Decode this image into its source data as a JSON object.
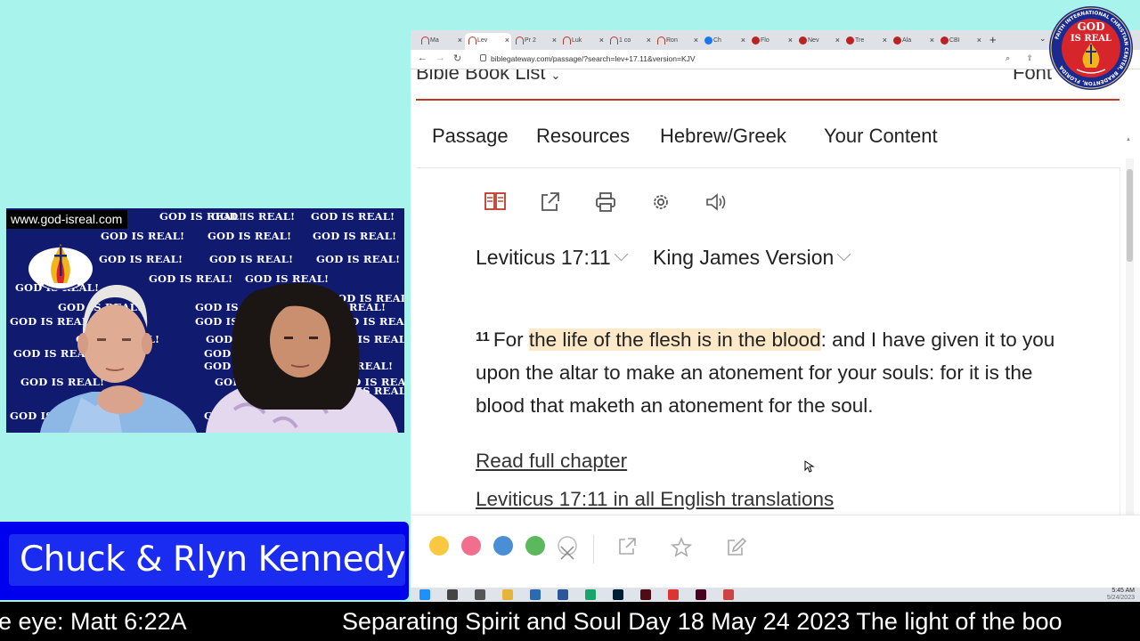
{
  "webcam": {
    "url_tag": "www.god-isreal.com",
    "backdrop_text": "GOD IS REAL!",
    "emblem_text": "GOD IS REAL"
  },
  "presenters": {
    "name": "Chuck & Rlyn Kennedy"
  },
  "ticker": {
    "left_fragment": "e eye: Matt 6:22A",
    "right_fragment": "Separating Spirit and Soul Day 18 May 24 2023 The light of the boo"
  },
  "corner_logo": {
    "line1": "GOD",
    "line2": "IS REAL",
    "ring_text": "FAITH INTERNATIONAL CHRISTIAN CENTER, BRADENTON, FLORIDA"
  },
  "browser": {
    "tabs": [
      {
        "label": "Ma",
        "icon": "bible-gateway-icon",
        "active": false
      },
      {
        "label": "Lev",
        "icon": "bible-gateway-icon",
        "active": true
      },
      {
        "label": "Pr 2",
        "icon": "bible-gateway-icon",
        "active": false
      },
      {
        "label": "Luk",
        "icon": "bible-gateway-icon",
        "active": false
      },
      {
        "label": "1 co",
        "icon": "bible-gateway-icon",
        "active": false
      },
      {
        "label": "Ron",
        "icon": "bible-gateway-icon",
        "active": false
      },
      {
        "label": "Ch",
        "icon": "facebook-icon",
        "active": false
      },
      {
        "label": "Flo",
        "icon": "site-icon",
        "active": false
      },
      {
        "label": "Nev",
        "icon": "site-icon",
        "active": false
      },
      {
        "label": "Tre",
        "icon": "site-icon",
        "active": false
      },
      {
        "label": "Ala",
        "icon": "site-icon",
        "active": false
      },
      {
        "label": "CBI",
        "icon": "site-icon",
        "active": false
      }
    ],
    "new_tab": "+",
    "address": "biblegateway.com/passage/?search=lev+17.11&version=KJV"
  },
  "page": {
    "book_list": "Bible Book List",
    "fonts_label": "Font",
    "nav": [
      "Passage",
      "Resources",
      "Hebrew/Greek",
      "Your Content"
    ],
    "toolbar_icons": [
      "parallel-view-icon",
      "share-icon",
      "print-icon",
      "settings-icon",
      "audio-icon"
    ],
    "reference": "Leviticus 17:11",
    "version": "King James Version",
    "verse": {
      "number": "11",
      "pre": "For ",
      "highlight": "the life of the flesh is in the blood",
      "post": ": and I have given it to you upon the altar to make an atonement for your souls: for it is the blood that maketh an atonement for the soul."
    },
    "links": {
      "read_full": "Read full chapter",
      "all_translations": "Leviticus 17:11 in all English translations"
    },
    "highlight_colors": [
      "#f9c841",
      "#ef6f8c",
      "#4a8ed6",
      "#5cb85c"
    ],
    "highlight_bar_icons": [
      "clear-highlight-icon",
      "share-icon",
      "star-icon",
      "edit-note-icon"
    ]
  },
  "taskbar": {
    "time": "5:45 AM",
    "date": "5/24/2023",
    "apps": [
      "windows-start-icon",
      "search-icon",
      "task-view-icon",
      "file-explorer-icon",
      "store-icon",
      "mail-icon",
      "edge-icon",
      "photoshop-icon",
      "dreamweaver-icon",
      "chrome-icon",
      "indesign-icon",
      "app-icon"
    ]
  },
  "colors": {
    "background": "#a8f4ec",
    "banner_blue": "#0000ee",
    "highlight": "#fde9c8",
    "rule_red": "#c0392b"
  }
}
